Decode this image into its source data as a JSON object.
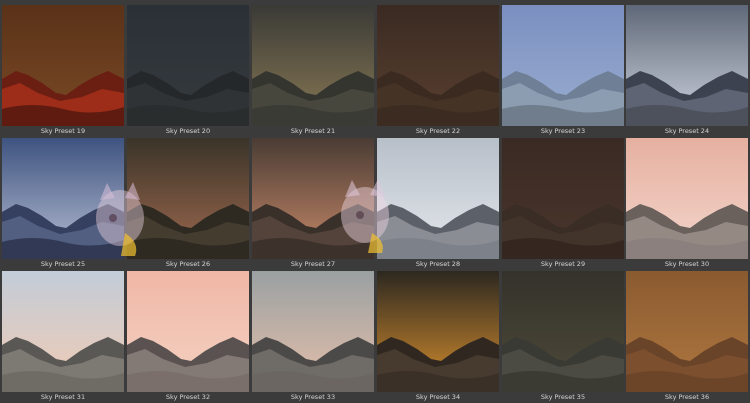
{
  "gallery": {
    "items": [
      {
        "label": "Sky Preset 19",
        "sky_top": "#5a3218",
        "sky_bottom": "#7a4a25",
        "mountain": "#6b1e12",
        "accent": "#c63a1e",
        "ground": "#5a1a10"
      },
      {
        "label": "Sky Preset 20",
        "sky_top": "#2a3036",
        "sky_bottom": "#353a3e",
        "mountain": "#25282b",
        "accent": "#3a3d40",
        "ground": "#2a2c2e"
      },
      {
        "label": "Sky Preset 21",
        "sky_top": "#3a3a36",
        "sky_bottom": "#8a7a55",
        "mountain": "#353530",
        "accent": "#55554a",
        "ground": "#3a3a35"
      },
      {
        "label": "Sky Preset 22",
        "sky_top": "#3a2a22",
        "sky_bottom": "#5a4030",
        "mountain": "#3a2a20",
        "accent": "#4e3a2c",
        "ground": "#3a2a20"
      },
      {
        "label": "Sky Preset 23",
        "sky_top": "#7a8fc0",
        "sky_bottom": "#9aaed0",
        "mountain": "#6e7f96",
        "accent": "#a8b6c8",
        "ground": "#6c7a8a"
      },
      {
        "label": "Sky Preset 24",
        "sky_top": "#5f6878",
        "sky_bottom": "#cfd6e0",
        "mountain": "#3c4250",
        "accent": "#7b8292",
        "ground": "#4a4f5a"
      },
      {
        "label": "Sky Preset 25",
        "sky_top": "#3e5380",
        "sky_bottom": "#b8bfd4",
        "mountain": "#354060",
        "accent": "#6a789c",
        "ground": "#2e3550"
      },
      {
        "label": "Sky Preset 26",
        "sky_top": "#3a3428",
        "sky_bottom": "#a06a50",
        "mountain": "#2e2a22",
        "accent": "#554a3a",
        "ground": "#2c2820"
      },
      {
        "label": "Sky Preset 27",
        "sky_top": "#4a3c34",
        "sky_bottom": "#c98a6a",
        "mountain": "#3a302a",
        "accent": "#6a5448",
        "ground": "#3a302a"
      },
      {
        "label": "Sky Preset 28",
        "sky_top": "#b7bfc9",
        "sky_bottom": "#e5e8ec",
        "mountain": "#5c6068",
        "accent": "#b0b2b8",
        "ground": "#7a7f88"
      },
      {
        "label": "Sky Preset 29",
        "sky_top": "#3a2a24",
        "sky_bottom": "#4a362c",
        "mountain": "#3a2d26",
        "accent": "#4a3a30",
        "ground": "#34261f"
      },
      {
        "label": "Sky Preset 30",
        "sky_top": "#e6b0a0",
        "sky_bottom": "#f3d6cc",
        "mountain": "#6a605c",
        "accent": "#b8aca6",
        "ground": "#8a807c"
      },
      {
        "label": "Sky Preset 31",
        "sky_top": "#c2ccd8",
        "sky_bottom": "#f2cbb4",
        "mountain": "#5a5854",
        "accent": "#9a958c",
        "ground": "#6e6a64"
      },
      {
        "label": "Sky Preset 32",
        "sky_top": "#f0b7a6",
        "sky_bottom": "#f4d2c2",
        "mountain": "#5a5250",
        "accent": "#a89a94",
        "ground": "#7a6e6a"
      },
      {
        "label": "Sky Preset 33",
        "sky_top": "#9aa0a2",
        "sky_bottom": "#e6c0aa",
        "mountain": "#4c4a48",
        "accent": "#8c8884",
        "ground": "#6a6662"
      },
      {
        "label": "Sky Preset 34",
        "sky_top": "#2c2820",
        "sky_bottom": "#d9902e",
        "mountain": "#302820",
        "accent": "#5a4a3a",
        "ground": "#3a3028"
      },
      {
        "label": "Sky Preset 35",
        "sky_top": "#34322a",
        "sky_bottom": "#4e4a3a",
        "mountain": "#3a3a34",
        "accent": "#5a5a50",
        "ground": "#3a3a32"
      },
      {
        "label": "Sky Preset 36",
        "sky_top": "#8a5a30",
        "sky_bottom": "#b07840",
        "mountain": "#6a4428",
        "accent": "#8a5a34",
        "ground": "#6a4428"
      }
    ]
  }
}
